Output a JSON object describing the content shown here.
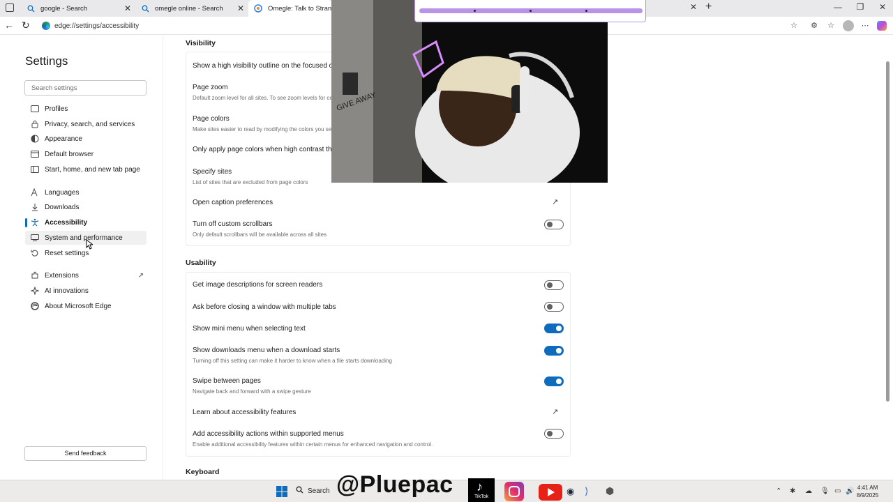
{
  "tabs": [
    {
      "label": "google - Search",
      "icon": "search-icon"
    },
    {
      "label": "omegle online - Search",
      "icon": "search-icon"
    },
    {
      "label": "Omegle: Talk to Strangers w",
      "icon": "omegle-icon"
    }
  ],
  "address": {
    "url": "edge://settings/accessibility"
  },
  "sidebar": {
    "title": "Settings",
    "search_placeholder": "Search settings",
    "items": [
      {
        "label": "Profiles",
        "icon": "profile-icon"
      },
      {
        "label": "Privacy, search, and services",
        "icon": "lock-icon"
      },
      {
        "label": "Appearance",
        "icon": "appearance-icon"
      },
      {
        "label": "Default browser",
        "icon": "browser-icon"
      },
      {
        "label": "Start, home, and new tab page",
        "icon": "home-icon"
      },
      {
        "label": "Languages",
        "icon": "languages-icon"
      },
      {
        "label": "Downloads",
        "icon": "download-icon"
      },
      {
        "label": "Accessibility",
        "icon": "accessibility-icon"
      },
      {
        "label": "System and performance",
        "icon": "system-icon"
      },
      {
        "label": "Reset settings",
        "icon": "reset-icon"
      },
      {
        "label": "Extensions",
        "icon": "extensions-icon"
      },
      {
        "label": "AI innovations",
        "icon": "ai-icon"
      },
      {
        "label": "About Microsoft Edge",
        "icon": "edge-icon"
      }
    ],
    "feedback": "Send feedback"
  },
  "visibility": {
    "title": "Visibility",
    "rows": [
      {
        "title": "Show a high visibility outline on the focused obj",
        "sub": ""
      },
      {
        "title": "Page zoom",
        "sub": "Default zoom level for all sites. To see zoom levels for ce"
      },
      {
        "title": "Page colors",
        "sub": "Make sites easier to read by modifying the colors you se"
      },
      {
        "title": "Only apply page colors when high contrast them",
        "sub": ""
      },
      {
        "title": "Specify sites",
        "sub": "List of sites that are excluded from page colors"
      },
      {
        "title": "Open caption preferences",
        "sub": ""
      },
      {
        "title": "Turn off custom scrollbars",
        "sub": "Only default scrollbars will be available across all sites"
      }
    ]
  },
  "usability": {
    "title": "Usability",
    "rows": [
      {
        "title": "Get image descriptions for screen readers",
        "sub": ""
      },
      {
        "title": "Ask before closing a window with multiple tabs",
        "sub": ""
      },
      {
        "title": "Show mini menu when selecting text",
        "sub": ""
      },
      {
        "title": "Show downloads menu when a download starts",
        "sub": "Turning off this setting can make it harder to know when a file starts downloading"
      },
      {
        "title": "Swipe between pages",
        "sub": "Navigate back and forward with a swipe gesture"
      },
      {
        "title": "Learn about accessibility features",
        "sub": ""
      },
      {
        "title": "Add accessibility actions within supported menus",
        "sub": "Enable additional accessibility features within certain menus for enhanced navigation and control."
      }
    ],
    "toggles": [
      false,
      false,
      true,
      true,
      true,
      null,
      false
    ]
  },
  "keyboard": {
    "title": "Keyboard"
  },
  "video": {
    "wall_text": "GIVE AWAY"
  },
  "taskbar": {
    "search": "Search",
    "watermark": "@Pluepac",
    "tiktok": "TikTok",
    "time": "4:41 AM",
    "date": "8/9/2025"
  },
  "colors": {
    "accent": "#0f6cbd",
    "progress": "#b893e6"
  }
}
